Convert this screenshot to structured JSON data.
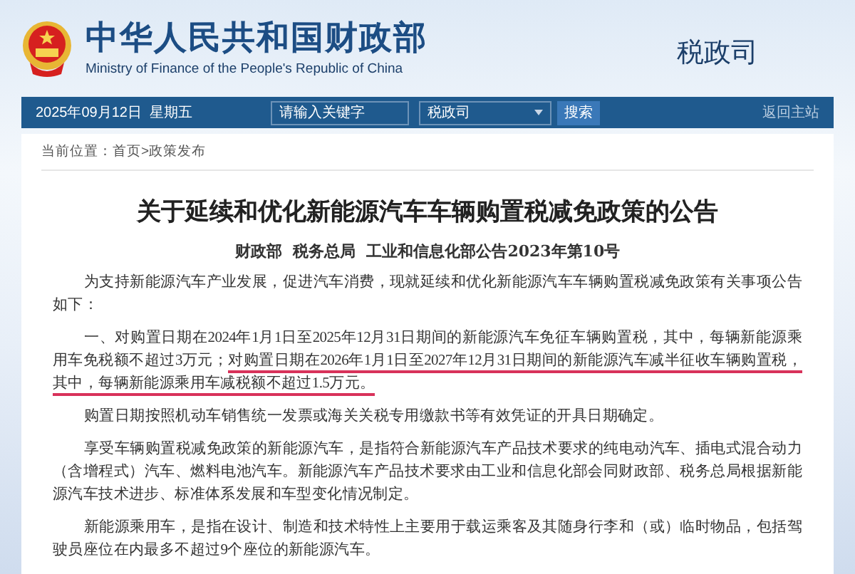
{
  "header": {
    "title": "中华人民共和国财政部",
    "subtitle": "Ministry of Finance of the People's Republic of China",
    "department": "税政司"
  },
  "nav": {
    "date": "2025年09月12日  星期五",
    "search": {
      "placeholder": "请输入关键字"
    },
    "scope": "税政司",
    "search_button": "搜索",
    "home_link": "返回主站"
  },
  "breadcrumb": [
    {
      "text": "当前位置："
    },
    {
      "text": "首页"
    },
    {
      "text": ">"
    },
    {
      "text": "政策发布"
    }
  ],
  "article": {
    "title": "关于延续和优化新能源汽车车辆购置税减免政策的公告",
    "issuer": "财政部  税务总局  工业和信息化部公告2023年第10号",
    "paragraphs": [
      [
        {
          "text": "为支持新能源汽车产业发展，促进汽车消费，现就延续和优化新能源汽车车辆购置税减免政策有关事项公告如下：",
          "underlined": false
        }
      ],
      [
        {
          "text": "一、对购置日期在2024年1月1日至2025年12月31日期间的新能源汽车免征车辆购置税，其中，每辆新能源乘用车免税额不超过3万元；",
          "underlined": false
        },
        {
          "text": "对购置日期在2026年1月1日至2027年12月31日期间的新能源汽车减半征收车辆购置税，其中，每辆新能源乘用车减税额不超过1.5万元。",
          "underlined": true
        }
      ],
      [
        {
          "text": "购置日期按照机动车销售统一发票或海关关税专用缴款书等有效凭证的开具日期确定。",
          "underlined": false
        }
      ],
      [
        {
          "text": "享受车辆购置税减免政策的新能源汽车，是指符合新能源汽车产品技术要求的纯电动汽车、插电式混合动力（含增程式）汽车、燃料电池汽车。新能源汽车产品技术要求由工业和信息化部会同财政部、税务总局根据新能源汽车技术进步、标准体系发展和车型变化情况制定。",
          "underlined": false
        }
      ],
      [
        {
          "text": "新能源乘用车，是指在设计、制造和技术特性上主要用于载运乘客及其随身行李和（或）临时物品，包括驾驶员座位在内最多不超过9个座位的新能源汽车。",
          "underlined": false
        }
      ]
    ]
  }
}
